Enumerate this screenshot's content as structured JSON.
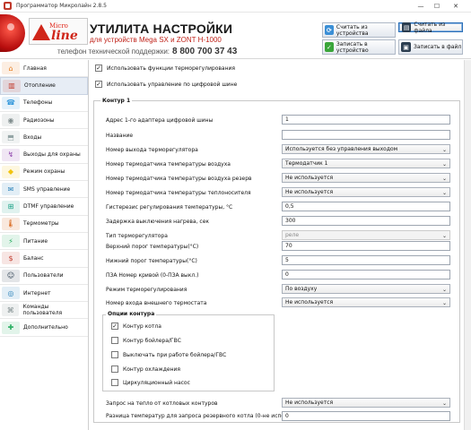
{
  "window": {
    "title": "Программатор Микролайн 2.8.5"
  },
  "header": {
    "logo_micro": "Micro",
    "logo_line": "line",
    "title": "УТИЛИТА НАСТРОЙКИ",
    "subtitle": "для устройств Mega SX и ZONT H-1000",
    "phone_label": "телефон технической поддержки:",
    "phone": "8 800 700 37 43",
    "buttons": {
      "read_device": "Считать из устройства",
      "read_file": "Считать из файла",
      "write_device": "Записать в устройство",
      "write_file": "Записать в файл"
    }
  },
  "sidebar": {
    "items": [
      {
        "label": "Главная",
        "icon": "home-icon"
      },
      {
        "label": "Отопление",
        "icon": "radiator-icon"
      },
      {
        "label": "Телефоны",
        "icon": "phone-icon"
      },
      {
        "label": "Радиозоны",
        "icon": "radio-icon"
      },
      {
        "label": "Входы",
        "icon": "input-icon"
      },
      {
        "label": "Выходы для охраны",
        "icon": "output-icon"
      },
      {
        "label": "Режим охраны",
        "icon": "guard-icon"
      },
      {
        "label": "SMS управление",
        "icon": "sms-icon"
      },
      {
        "label": "DTMF управление",
        "icon": "dtmf-icon"
      },
      {
        "label": "Термометры",
        "icon": "thermometer-icon"
      },
      {
        "label": "Питание",
        "icon": "power-icon"
      },
      {
        "label": "Баланс",
        "icon": "balance-icon"
      },
      {
        "label": "Пользователи",
        "icon": "users-icon"
      },
      {
        "label": "Интернет",
        "icon": "internet-icon"
      },
      {
        "label": "Команды пользователя",
        "icon": "commands-icon"
      },
      {
        "label": "Дополнительно",
        "icon": "extra-icon"
      }
    ],
    "active_index": 1
  },
  "options": {
    "use_thermoregulation": "Использовать функции терморегулирования",
    "use_digital_bus": "Использовать управление по цифровой шине"
  },
  "contour": {
    "title": "Контур 1",
    "fields": [
      {
        "label": "Адрес 1-го адаптера цифровой шины",
        "value": "1",
        "kind": "input"
      },
      {
        "label": "Название",
        "value": "",
        "kind": "input"
      },
      {
        "label": "Номер выхода терморегулятора",
        "value": "Используется без управления выходом",
        "kind": "select"
      },
      {
        "label": "Номер термодатчика температуры воздуха",
        "value": "Термодатчик 1",
        "kind": "select"
      },
      {
        "label": "Номер термодатчика температуры воздуха резерв",
        "value": "Не используется",
        "kind": "select"
      },
      {
        "label": "Номер термодатчика температуры теплоносителя",
        "value": "Не используется",
        "kind": "select"
      },
      {
        "label": "Гистерезис регулирования температуры, °C",
        "value": "0,5",
        "kind": "input"
      },
      {
        "label": "Задержка выключения нагрева, сек",
        "value": "300",
        "kind": "input"
      },
      {
        "label": "Тип терморегулятора",
        "value": "реле",
        "kind": "select-disabled"
      },
      {
        "label": "Верхний порог температуры(°C)",
        "value": "70",
        "kind": "input"
      },
      {
        "label": "Нижний порог температуры(°C)",
        "value": "5",
        "kind": "input"
      },
      {
        "label": "ПЗА Номер кривой (0-ПЗА выкл.)",
        "value": "0",
        "kind": "input"
      },
      {
        "label": "Режим терморегулирования",
        "value": "По воздуху",
        "kind": "select"
      },
      {
        "label": "Номер входа внешнего термостата",
        "value": "Не используется",
        "kind": "select"
      }
    ],
    "options_title": "Опции контура",
    "options": [
      {
        "label": "Контур котла",
        "checked": true
      },
      {
        "label": "Контур бойлера/ГВС",
        "checked": false
      },
      {
        "label": "Выключать при работе бойлера/ГВС",
        "checked": false
      },
      {
        "label": "Контур охлаждения",
        "checked": false
      },
      {
        "label": "Циркуляционный насос",
        "checked": false
      }
    ],
    "heat_request_label": "Запрос на тепло от котловых контуров",
    "heat_request_value": "Не используется",
    "diff_label": "Разница температур для запроса резервного котла (0-не используется)",
    "diff_value": "0"
  }
}
